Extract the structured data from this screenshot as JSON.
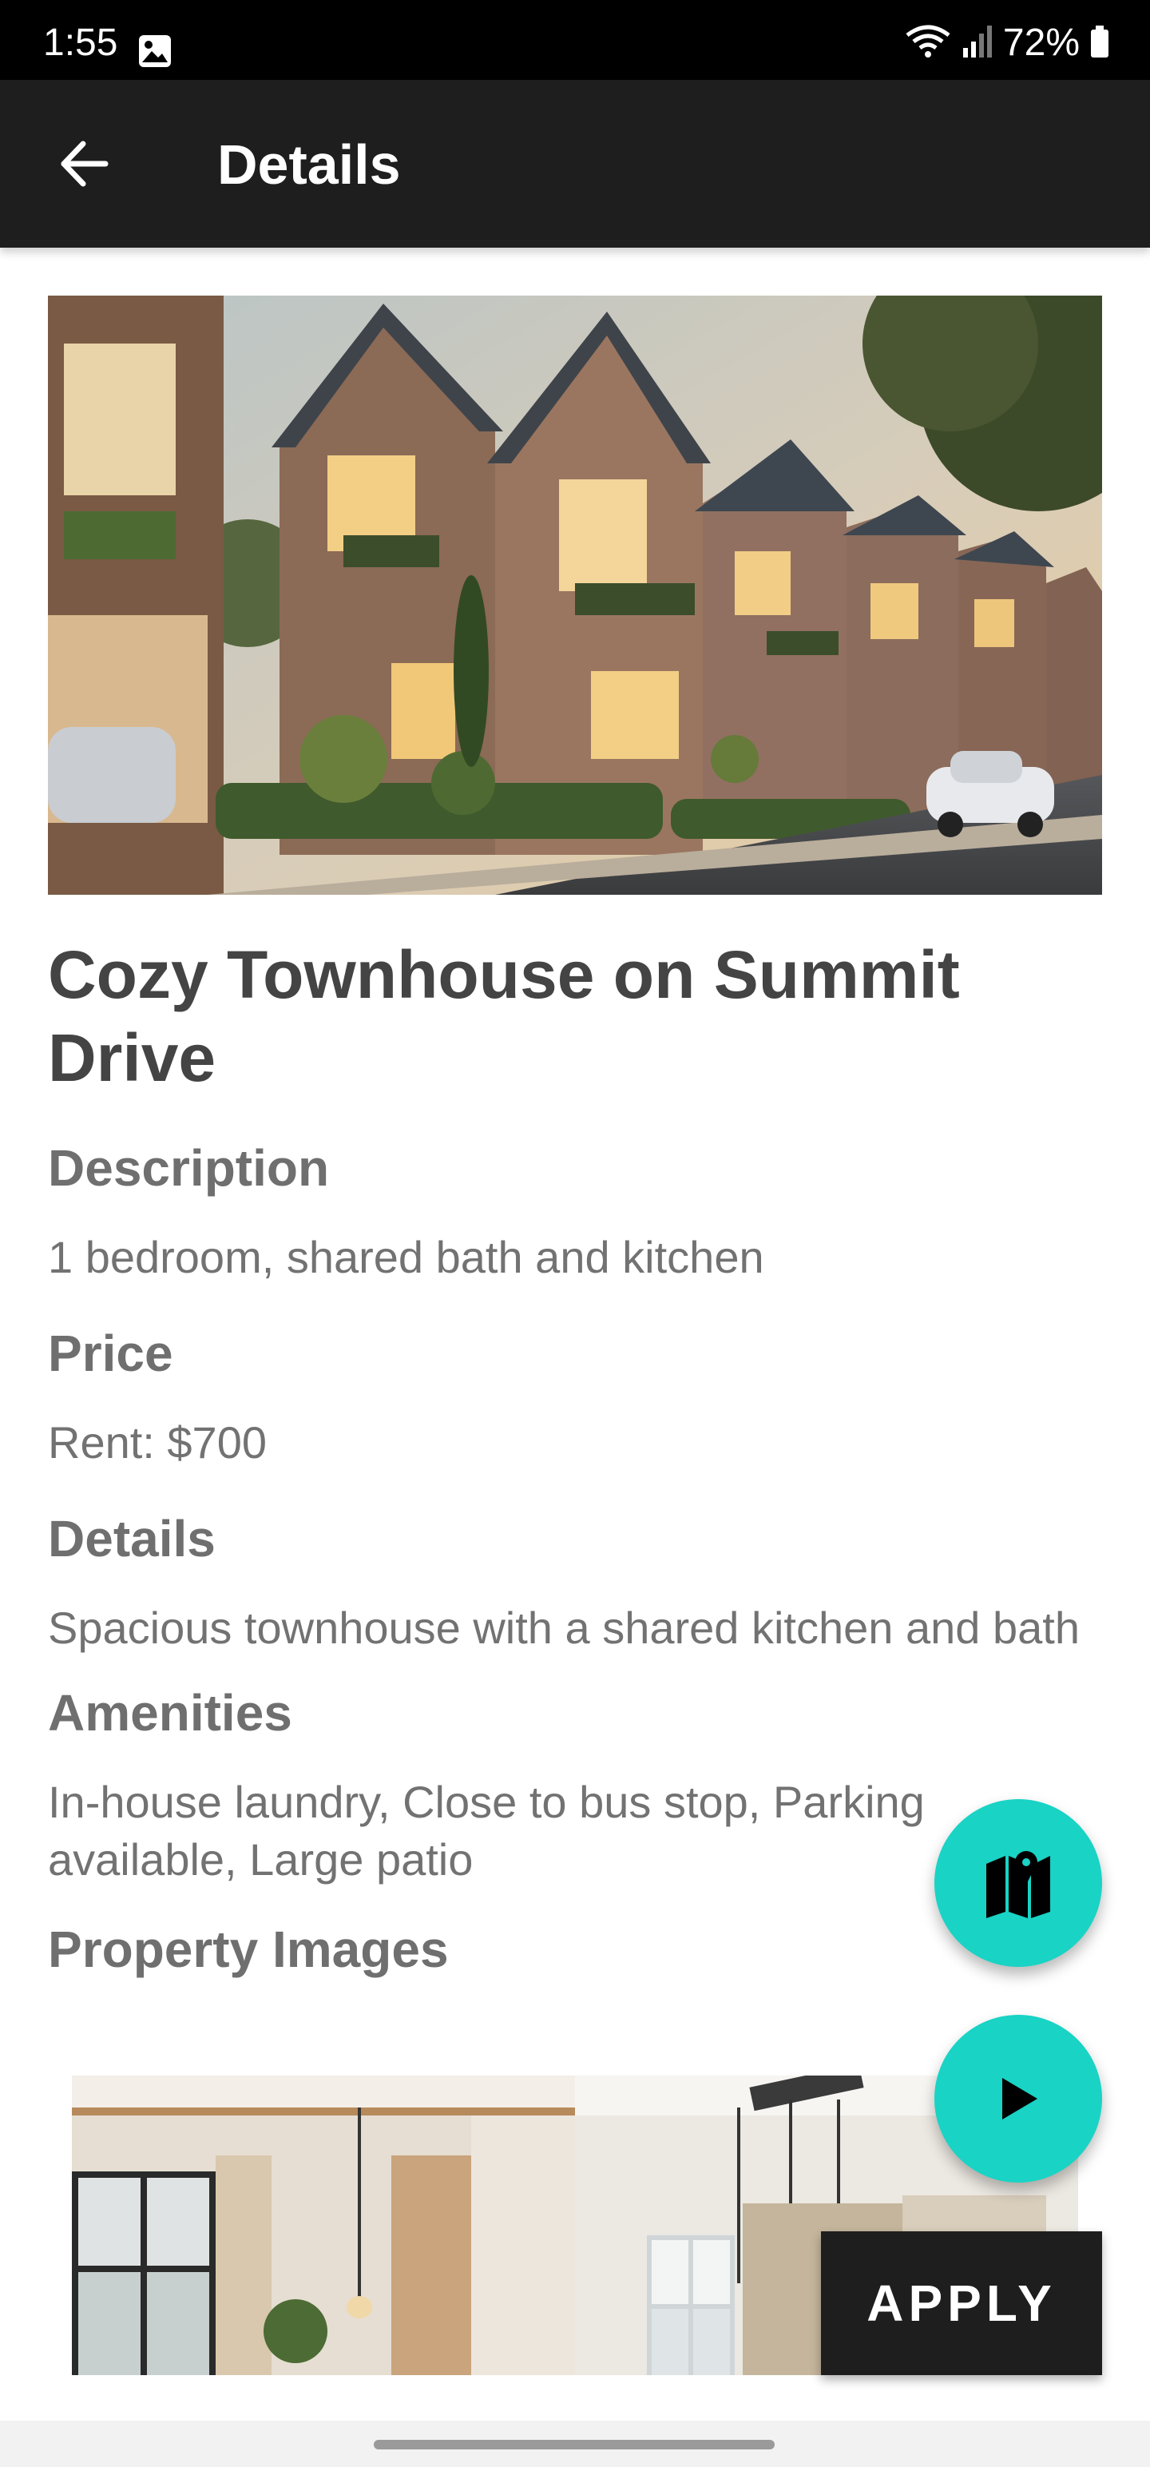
{
  "status_bar": {
    "time": "1:55",
    "battery": "72%",
    "icons": [
      "gallery-icon",
      "wifi-icon",
      "signal-icon",
      "battery-icon"
    ]
  },
  "app_bar": {
    "title": "Details",
    "back_icon": "arrow-left-icon"
  },
  "listing": {
    "title": "Cozy Townhouse on Summit Drive",
    "description_heading": "Description",
    "description": "1 bedroom, shared bath and kitchen",
    "price_heading": "Price",
    "price": "Rent: $700",
    "details_heading": "Details",
    "details": "Spacious townhouse with a shared kitchen and bath",
    "amenities_heading": "Amenities",
    "amenities": "In-house laundry, Close to bus stop, Parking available, Large patio",
    "images_heading": "Property Images"
  },
  "actions": {
    "map_icon": "map-icon",
    "play_icon": "play-icon",
    "apply_label": "APPLY"
  },
  "colors": {
    "app_bar": "#1e1e1e",
    "accent": "#19d3c5",
    "heading": "#6f6f6f",
    "title": "#444444"
  }
}
